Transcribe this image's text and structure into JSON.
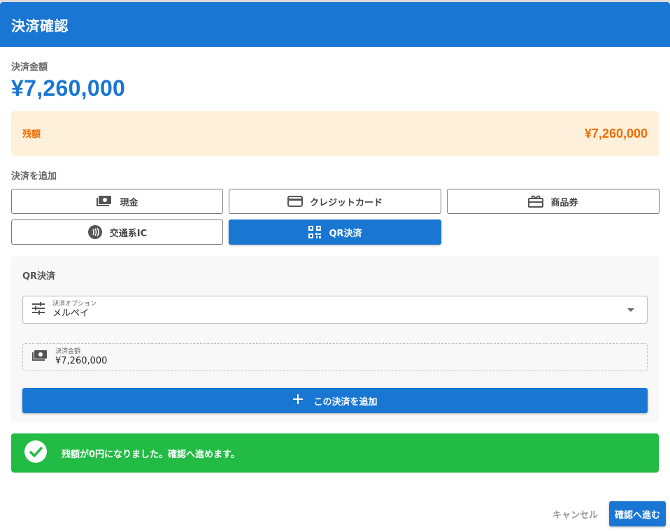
{
  "dialog": {
    "title": "決済確認"
  },
  "amount": {
    "label": "決済金額",
    "value": "¥7,260,000"
  },
  "remaining": {
    "label": "残額",
    "value": "¥7,260,000"
  },
  "add_payment": {
    "label": "決済を追加",
    "methods": [
      {
        "label": "現金",
        "icon": "cash-icon",
        "selected": false
      },
      {
        "label": "クレジットカード",
        "icon": "credit-card-icon",
        "selected": false
      },
      {
        "label": "商品券",
        "icon": "gift-card-icon",
        "selected": false
      },
      {
        "label": "交通系IC",
        "icon": "contactless-icon",
        "selected": false
      },
      {
        "label": "QR決済",
        "icon": "qr-code-icon",
        "selected": true
      }
    ]
  },
  "qr_panel": {
    "title": "QR決済",
    "option_field": {
      "label": "決済オプション",
      "value": "メルペイ",
      "icon": "tune-icon"
    },
    "amount_field": {
      "label": "決済金額",
      "value": "¥7,260,000",
      "icon": "cash-icon"
    },
    "add_button": "この決済を追加"
  },
  "success_message": "残額が0円になりました。確認へ進めます。",
  "footer": {
    "cancel": "キャンセル",
    "confirm": "確認へ進む"
  },
  "colors": {
    "primary": "#1976d2",
    "warning_bg": "#fff0dc",
    "warning_text": "#ef6c00",
    "success": "#22bb44"
  }
}
